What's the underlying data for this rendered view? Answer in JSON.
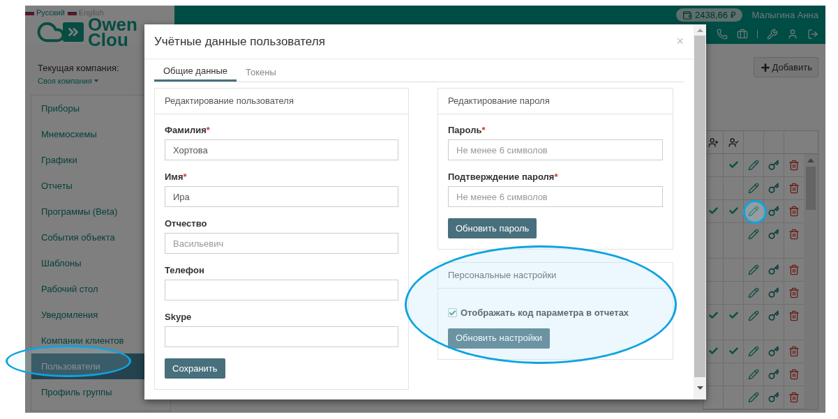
{
  "languages": [
    {
      "label": "Русский",
      "selected": true
    },
    {
      "label": "English",
      "selected": false
    }
  ],
  "logo": {
    "line1": "Owen",
    "line2": "Clou"
  },
  "header": {
    "balance": "2438,66 ₽",
    "user": "Малыгина Анна"
  },
  "company": {
    "label": "Текущая компания:",
    "value": "Своя компания"
  },
  "sidebar": {
    "items": [
      {
        "label": "Приборы",
        "selected": false
      },
      {
        "label": "Мнемосхемы",
        "selected": false
      },
      {
        "label": "Графики",
        "selected": false
      },
      {
        "label": "Отчеты",
        "selected": false
      },
      {
        "label": "Программы (Beta)",
        "selected": false
      },
      {
        "label": "События объекта",
        "selected": false
      },
      {
        "label": "Шаблоны",
        "selected": false
      },
      {
        "label": "Рабочий стол",
        "selected": false
      },
      {
        "label": "Уведомления",
        "selected": false
      },
      {
        "label": "Компании клиентов",
        "selected": false
      },
      {
        "label": "Пользователи",
        "selected": true
      },
      {
        "label": "Профиль группы",
        "selected": false
      }
    ]
  },
  "add_button": "Добавить",
  "table": {
    "rows": [
      {
        "invited": false,
        "confirmed": true,
        "tall": false
      },
      {
        "invited": false,
        "confirmed": false,
        "tall": false
      },
      {
        "invited": true,
        "confirmed": true,
        "tall": false
      },
      {
        "invited": false,
        "confirmed": false,
        "tall": true
      },
      {
        "invited": false,
        "confirmed": false,
        "tall": false
      },
      {
        "invited": false,
        "confirmed": false,
        "tall": false
      },
      {
        "invited": true,
        "confirmed": true,
        "tall": true
      },
      {
        "invited": true,
        "confirmed": true,
        "tall": false
      },
      {
        "invited": false,
        "confirmed": false,
        "tall": false
      },
      {
        "invited": false,
        "confirmed": false,
        "tall": false
      }
    ]
  },
  "dialog": {
    "title": "Учётные данные пользователя",
    "close": "×",
    "tabs": [
      {
        "label": "Общие данные",
        "selected": true
      },
      {
        "label": "Токены",
        "selected": false
      }
    ],
    "user_panel": {
      "title": "Редактирование пользователя",
      "fields": [
        {
          "label": "Фамилия",
          "required_mark": "*",
          "value": "Хортова"
        },
        {
          "label": "Имя",
          "required_mark": "*",
          "value": "Ира"
        },
        {
          "label": "Отчество",
          "placeholder": "Васильевич"
        },
        {
          "label": "Телефон"
        },
        {
          "label": "Skype"
        }
      ],
      "button": "Сохранить"
    },
    "password_panel": {
      "title": "Редактирование пароля",
      "fields": [
        {
          "label": "Пароль",
          "required_mark": "*",
          "placeholder": "Не менее 6 символов"
        },
        {
          "label": "Подтверждение пароля",
          "required_mark": "*",
          "placeholder": "Не менее 6 символов"
        }
      ],
      "button": "Обновить пароль"
    },
    "settings_panel": {
      "title": "Персональные настройки",
      "checkbox": {
        "label": "Отображать код параметра в отчетах",
        "checked": true
      },
      "button": "Обновить настройки"
    }
  }
}
